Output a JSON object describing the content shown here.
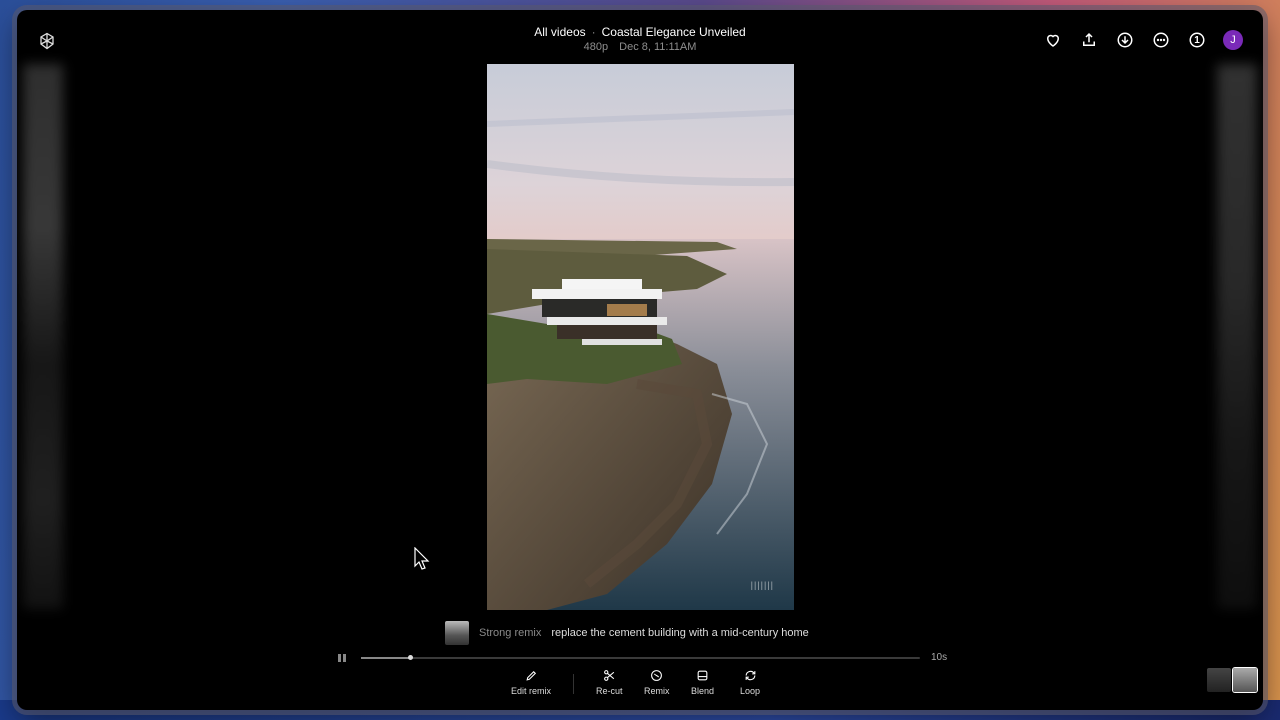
{
  "breadcrumb": {
    "all_videos": "All videos",
    "separator": "·",
    "video_title": "Coastal Elegance Unveiled"
  },
  "meta": {
    "resolution": "480p",
    "date": "Dec 8, 11:11AM"
  },
  "toolbar": {
    "icons": [
      "heart-icon",
      "share-icon",
      "download-icon",
      "more-icon",
      "count-badge-icon"
    ],
    "count_badge": "1",
    "avatar_initial": "J",
    "avatar_color": "#7a2ab8"
  },
  "video": {
    "watermark": "|||||||"
  },
  "prompt": {
    "tag": "Strong remix",
    "text": "replace the cement building with a mid-century home"
  },
  "playback": {
    "progress": 0.088,
    "duration_label": "10s"
  },
  "actions": {
    "edit_remix": "Edit remix",
    "recut": "Re-cut",
    "remix": "Remix",
    "blend": "Blend",
    "loop": "Loop"
  }
}
